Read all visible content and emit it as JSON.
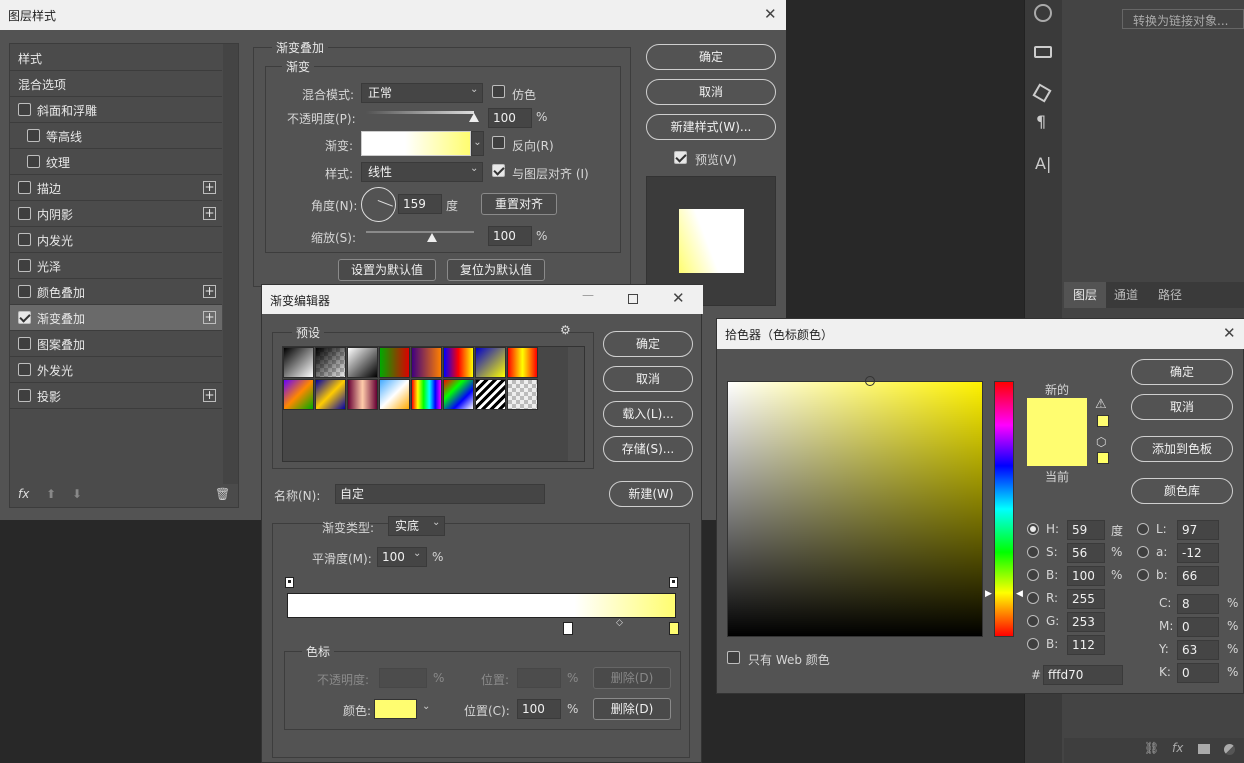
{
  "layer_style": {
    "title": "图层样式",
    "close": "✕",
    "list": [
      {
        "label": "样式",
        "check": false,
        "has_check": false,
        "plus": false
      },
      {
        "label": "混合选项",
        "check": false,
        "has_check": false,
        "plus": false
      },
      {
        "label": "斜面和浮雕",
        "check": false,
        "has_check": true,
        "plus": false
      },
      {
        "label": "等高线",
        "check": false,
        "has_check": true,
        "plus": false,
        "indent": true
      },
      {
        "label": "纹理",
        "check": false,
        "has_check": true,
        "plus": false,
        "indent": true
      },
      {
        "label": "描边",
        "check": false,
        "has_check": true,
        "plus": true
      },
      {
        "label": "内阴影",
        "check": false,
        "has_check": true,
        "plus": true
      },
      {
        "label": "内发光",
        "check": false,
        "has_check": true,
        "plus": false
      },
      {
        "label": "光泽",
        "check": false,
        "has_check": true,
        "plus": false
      },
      {
        "label": "颜色叠加",
        "check": false,
        "has_check": true,
        "plus": true
      },
      {
        "label": "渐变叠加",
        "check": true,
        "has_check": true,
        "plus": true,
        "selected": true
      },
      {
        "label": "图案叠加",
        "check": false,
        "has_check": true,
        "plus": false
      },
      {
        "label": "外发光",
        "check": false,
        "has_check": true,
        "plus": false
      },
      {
        "label": "投影",
        "check": false,
        "has_check": true,
        "plus": true
      }
    ],
    "fx": "fx",
    "section_title": "渐变叠加",
    "sub_title": "渐变",
    "blend_label": "混合模式:",
    "blend_value": "正常",
    "dither_label": "仿色",
    "opacity_label": "不透明度(P):",
    "opacity_value": "100",
    "pct": "%",
    "gradient_label": "渐变:",
    "reverse_label": "反向(R)",
    "style_label": "样式:",
    "style_value": "线性",
    "align_label": "与图层对齐 (I)",
    "angle_label": "角度(N):",
    "angle_value": "159",
    "degree": "度",
    "reset_align": "重置对齐",
    "scale_label": "缩放(S):",
    "scale_value": "100",
    "set_default": "设置为默认值",
    "reset_default": "复位为默认值",
    "ok": "确定",
    "cancel": "取消",
    "new_style": "新建样式(W)...",
    "preview_label": "预览(V)"
  },
  "right_panel": {
    "convert_link": "转换为链接对象...",
    "tabs": [
      "图层",
      "通道",
      "路径"
    ]
  },
  "gradient_editor": {
    "title": "渐变编辑器",
    "presets_label": "预设",
    "ok": "确定",
    "cancel": "取消",
    "load": "载入(L)...",
    "save": "存储(S)...",
    "name_label": "名称(N):",
    "name_value": "自定",
    "new": "新建(W)",
    "type_label": "渐变类型:",
    "type_value": "实底",
    "smooth_label": "平滑度(M):",
    "smooth_value": "100",
    "pct": "%",
    "stops_title": "色标",
    "opacity_label": "不透明度:",
    "position_label": "位置:",
    "delete": "删除(D)",
    "color_label": "颜色:",
    "position_c_label": "位置(C):",
    "position_c_value": "100",
    "stop_color": "#fffd70"
  },
  "color_picker": {
    "title": "拾色器（色标颜色）",
    "new_label": "新的",
    "current_label": "当前",
    "ok": "确定",
    "cancel": "取消",
    "add_swatch": "添加到色板",
    "color_lib": "颜色库",
    "web_only": "只有 Web 颜色",
    "hex_prefix": "#",
    "hex": "fffd70",
    "fields": {
      "H": "59",
      "S": "56",
      "B": "100",
      "R": "255",
      "G": "253",
      "Bb": "112",
      "L": "97",
      "a": "-12",
      "b": "66",
      "C": "8",
      "M": "0",
      "Y": "63",
      "K": "0"
    },
    "units": {
      "deg": "度",
      "pct": "%"
    },
    "labels": {
      "H": "H:",
      "S": "S:",
      "B": "B:",
      "R": "R:",
      "G": "G:",
      "Bb": "B:",
      "L": "L:",
      "a": "a:",
      "b": "b:",
      "C": "C:",
      "M": "M:",
      "Y": "Y:",
      "K": "K:"
    },
    "new_color": "#fffd70",
    "current_color": "#fffd70",
    "hue_color": "#fff200"
  }
}
